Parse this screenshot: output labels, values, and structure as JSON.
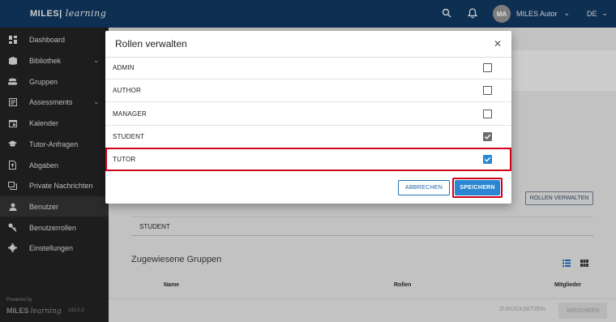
{
  "topbar": {
    "brand": "MILES",
    "brand_script": "learning",
    "avatar_initials": "MA",
    "user_name": "MILES Autor",
    "language": "DE"
  },
  "sidebar": {
    "items": [
      {
        "label": "Dashboard",
        "icon": "dashboard-icon"
      },
      {
        "label": "Bibliothek",
        "icon": "library-icon",
        "has_chevron": true
      },
      {
        "label": "Gruppen",
        "icon": "groups-icon"
      },
      {
        "label": "Assessments",
        "icon": "assessments-icon",
        "has_chevron": true
      },
      {
        "label": "Kalender",
        "icon": "calendar-icon"
      },
      {
        "label": "Tutor-Anfragen",
        "icon": "graduation-cap-icon"
      },
      {
        "label": "Abgaben",
        "icon": "submissions-icon"
      },
      {
        "label": "Private Nachrichten",
        "icon": "messages-icon"
      },
      {
        "label": "Benutzer",
        "icon": "user-icon",
        "active": true
      },
      {
        "label": "Benutzerrollen",
        "icon": "key-icon"
      },
      {
        "label": "Einstellungen",
        "icon": "gear-icon"
      }
    ],
    "powered_by": "Powered by",
    "footer_brand": "MILES",
    "footer_brand_script": "learning",
    "version": "v33.0.3"
  },
  "main": {
    "manage_roles_button": "ROLLEN VERWALTEN",
    "role_value": "STUDENT",
    "assigned_groups_title": "Zugewiesene Gruppen",
    "columns": {
      "name": "Name",
      "roles": "Rollen",
      "members": "Mitglieder"
    },
    "reset_button": "ZURÜCKSETZEN",
    "save_button": "SPEICHERN"
  },
  "dialog": {
    "title": "Rollen verwalten",
    "roles": [
      {
        "label": "ADMIN",
        "checked": false
      },
      {
        "label": "AUTHOR",
        "checked": false
      },
      {
        "label": "MANAGER",
        "checked": false
      },
      {
        "label": "STUDENT",
        "checked": true,
        "disabled": true
      },
      {
        "label": "TUTOR",
        "checked": true
      }
    ],
    "cancel_button": "ABBRECHEN",
    "save_button": "SPEICHERN"
  },
  "colors": {
    "primary": "#2a86d1",
    "highlight": "#d0001a",
    "sidebar": "#1d1d1d"
  }
}
